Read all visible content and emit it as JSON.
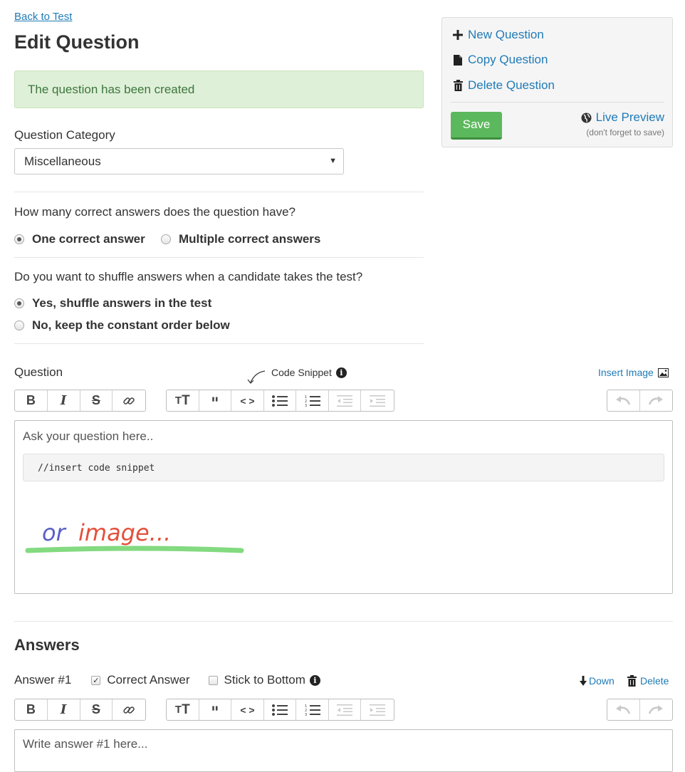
{
  "header": {
    "back_link": "Back to Test",
    "title": "Edit Question"
  },
  "alert": {
    "message": "The question has been created",
    "color": "#dff0d8"
  },
  "category": {
    "label": "Question Category",
    "selected": "Miscellaneous"
  },
  "correct_answers": {
    "question": "How many correct answers does the question have?",
    "options": [
      {
        "label": "One correct answer",
        "checked": true
      },
      {
        "label": "Multiple correct answers",
        "checked": false
      }
    ]
  },
  "shuffle": {
    "question": "Do you want to shuffle answers when a candidate takes the test?",
    "options": [
      {
        "label": "Yes, shuffle answers in the test",
        "checked": true
      },
      {
        "label": "No, keep the constant order below",
        "checked": false
      }
    ]
  },
  "sidebar": {
    "new_question": "New Question",
    "copy_question": "Copy Question",
    "delete_question": "Delete Question",
    "save": "Save",
    "live_preview": "Live Preview",
    "save_hint": "(don't forget to save)",
    "save_color": "#5cb85c"
  },
  "question_editor": {
    "label": "Question",
    "code_snippet_hint": "Code Snippet",
    "insert_image": "Insert Image",
    "placeholder": "Ask your question here..",
    "code_placeholder": "//insert code snippet",
    "image_hint_part1": "or",
    "image_hint_part2": "image..."
  },
  "toolbar": {
    "format_icons": [
      "bold-icon",
      "italic-icon",
      "strikethrough-icon",
      "link-icon"
    ],
    "block_icons": [
      "text-size-icon",
      "quote-icon",
      "code-icon",
      "bullet-list-icon",
      "numbered-list-icon",
      "outdent-icon",
      "indent-icon"
    ],
    "history_icons": [
      "undo-icon",
      "redo-icon"
    ]
  },
  "answers": {
    "title": "Answers",
    "answer_label": "Answer #1",
    "correct_label": "Correct Answer",
    "correct_checked": true,
    "stick_label": "Stick to Bottom",
    "stick_checked": false,
    "down": "Down",
    "delete": "Delete",
    "placeholder": "Write answer #1 here..."
  }
}
